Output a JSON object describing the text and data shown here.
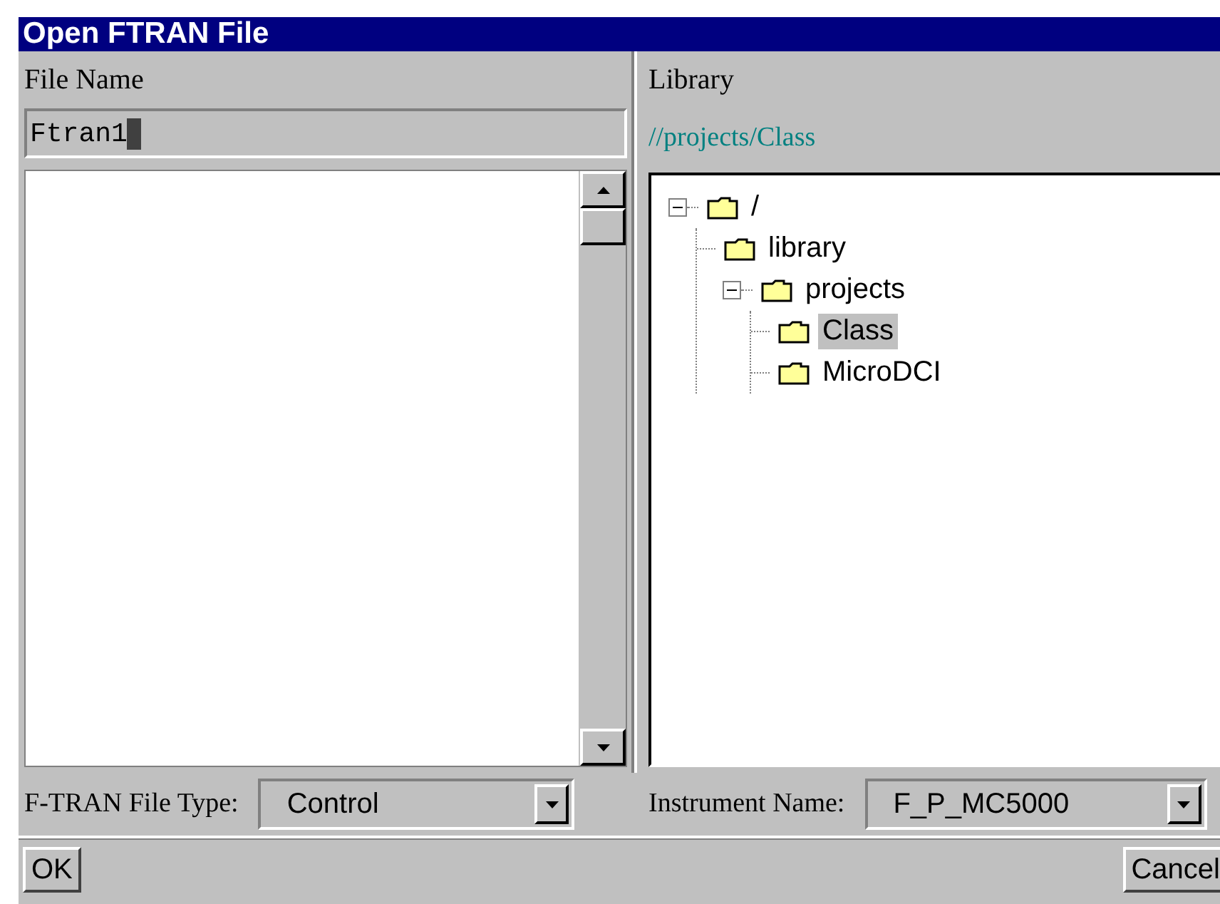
{
  "window": {
    "title": "Open FTRAN File"
  },
  "file_name": {
    "label": "File Name",
    "value": "Ftran1"
  },
  "library": {
    "label": "Library",
    "path": "//projects/Class",
    "tree": [
      {
        "label": "/",
        "expanded": true,
        "selected": false,
        "children": [
          {
            "label": "library",
            "selected": false
          },
          {
            "label": "projects",
            "expanded": true,
            "selected": false,
            "children": [
              {
                "label": "Class",
                "selected": true
              },
              {
                "label": "MicroDCI",
                "selected": false
              }
            ]
          }
        ]
      }
    ]
  },
  "file_type": {
    "label": "F-TRAN File Type:",
    "value": "Control"
  },
  "instrument": {
    "label": "Instrument Name:",
    "value": "F_P_MC5000"
  },
  "buttons": [
    "OK",
    "Cancel"
  ]
}
